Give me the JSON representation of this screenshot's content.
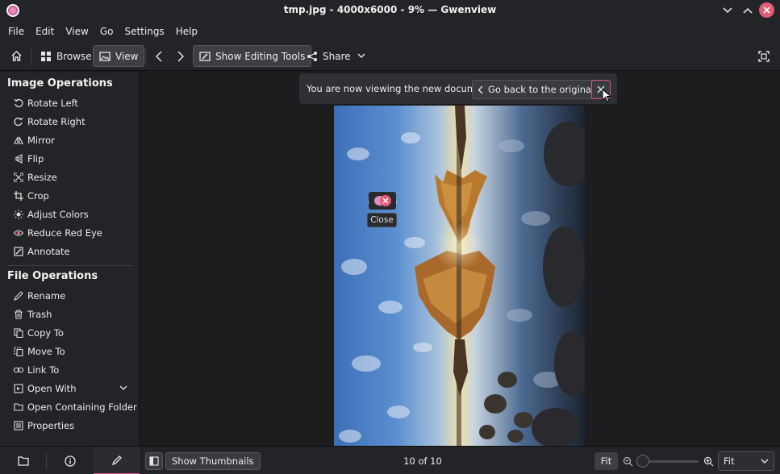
{
  "window": {
    "title": "tmp.jpg - 4000x6000 - 9% — Gwenview"
  },
  "menu": [
    "File",
    "Edit",
    "View",
    "Go",
    "Settings",
    "Help"
  ],
  "toolbar": {
    "browse_label": "Browse",
    "view_label": "View",
    "edit_tools_label": "Show Editing Tools",
    "share_label": "Share"
  },
  "sidebar": {
    "image_ops_title": "Image Operations",
    "image_ops": [
      {
        "label": "Rotate Left",
        "icon": "rotate-left-icon"
      },
      {
        "label": "Rotate Right",
        "icon": "rotate-right-icon"
      },
      {
        "label": "Mirror",
        "icon": "mirror-icon"
      },
      {
        "label": "Flip",
        "icon": "flip-icon"
      },
      {
        "label": "Resize",
        "icon": "resize-icon"
      },
      {
        "label": "Crop",
        "icon": "crop-icon"
      },
      {
        "label": "Adjust Colors",
        "icon": "adjust-colors-icon"
      },
      {
        "label": "Reduce Red Eye",
        "icon": "red-eye-icon"
      },
      {
        "label": "Annotate",
        "icon": "annotate-icon"
      }
    ],
    "file_ops_title": "File Operations",
    "file_ops": [
      {
        "label": "Rename",
        "icon": "rename-icon"
      },
      {
        "label": "Trash",
        "icon": "trash-icon"
      },
      {
        "label": "Copy To",
        "icon": "copy-icon"
      },
      {
        "label": "Move To",
        "icon": "move-icon"
      },
      {
        "label": "Link To",
        "icon": "link-icon"
      },
      {
        "label": "Open With",
        "icon": "open-with-icon"
      },
      {
        "label": "Open Containing Folder",
        "icon": "folder-icon"
      },
      {
        "label": "Properties",
        "icon": "properties-icon"
      }
    ]
  },
  "notification": {
    "message": "You are now viewing the new document.",
    "go_back_label": "Go back to the original"
  },
  "tooltip": {
    "label": "Close"
  },
  "bottombar": {
    "show_thumbnails_label": "Show Thumbnails",
    "counter": "10 of 10",
    "fit_label": "Fit",
    "zoom_value": "Fit"
  },
  "colors": {
    "accent": "#e0508d",
    "close_red": "#e35b74",
    "background": "#1d1d1f",
    "panel": "#232427"
  }
}
